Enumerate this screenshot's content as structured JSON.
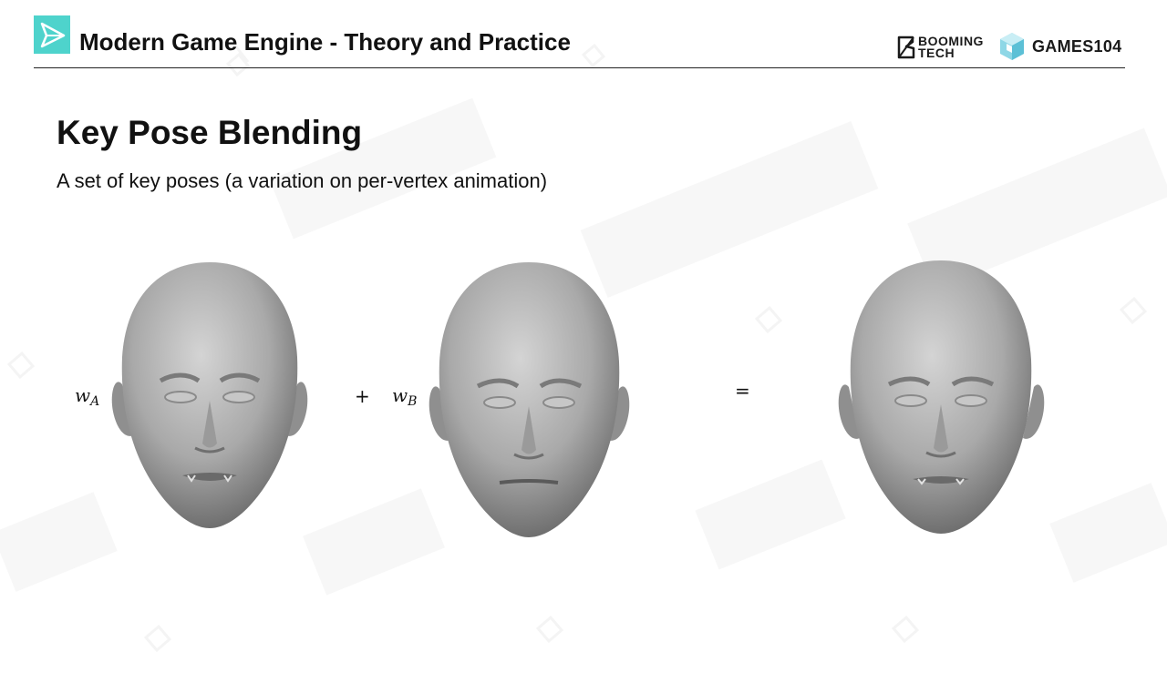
{
  "header": {
    "title": "Modern Game Engine - Theory and Practice",
    "brand_booming_line1": "BOOMING",
    "brand_booming_line2": "TECH",
    "brand_games": "GAMES104"
  },
  "slide": {
    "title": "Key Pose Blending",
    "subtitle": "A set of key poses (a variation on per-vertex animation)"
  },
  "equation": {
    "weight_a_symbol": "w",
    "weight_a_subscript": "A",
    "plus": "+",
    "weight_b_symbol": "w",
    "weight_b_subscript": "B",
    "equals": "="
  },
  "faces": {
    "a": "key-pose-a-face",
    "b": "key-pose-b-face",
    "result": "blended-result-face"
  },
  "colors": {
    "accent": "#4ed3cc",
    "text": "#111111",
    "rule": "#222222",
    "face_mid": "#a9a9a9",
    "face_light": "#d0d0d0",
    "face_dark": "#6f6f6f"
  }
}
